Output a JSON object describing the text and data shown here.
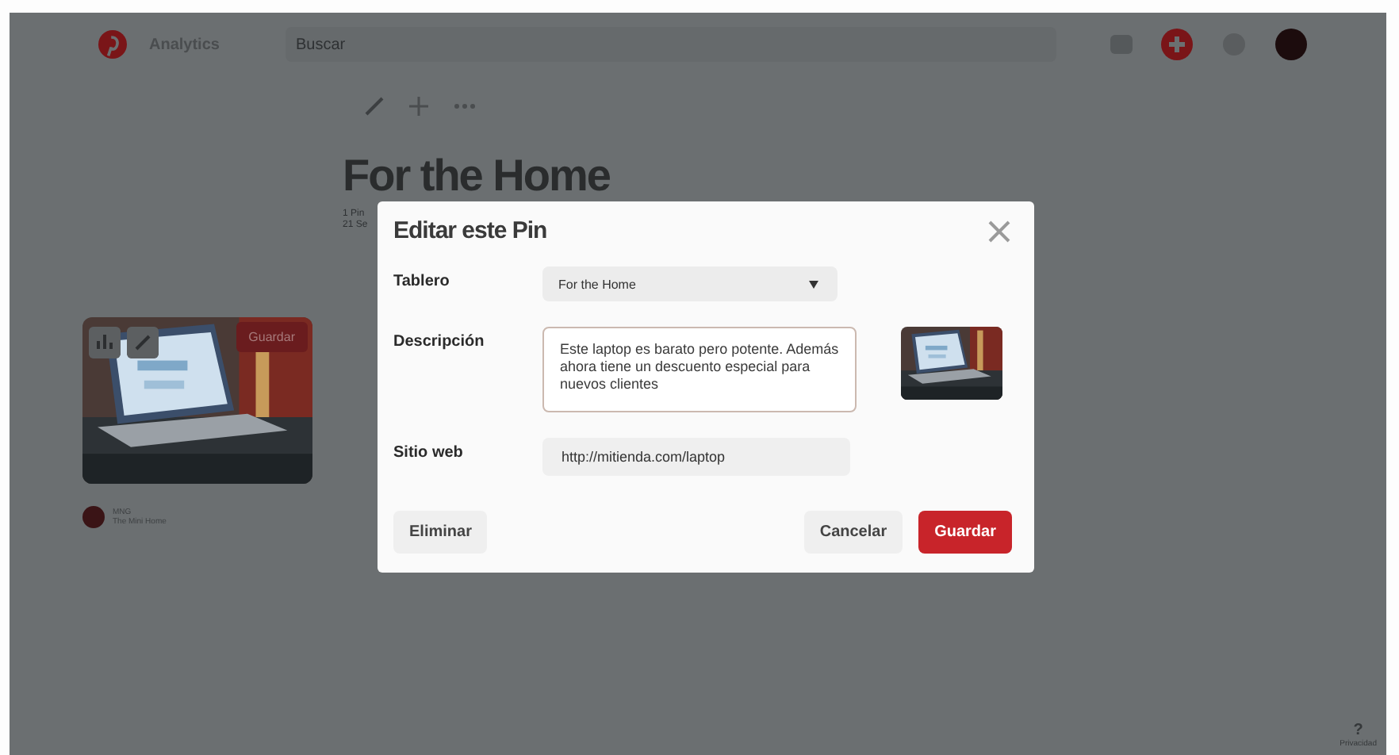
{
  "header": {
    "nav": [
      "Analytics"
    ],
    "search": {
      "placeholder": "Buscar"
    }
  },
  "board": {
    "title": "For the Home",
    "meta": [
      "1 Pin",
      "21 Se"
    ]
  },
  "pin": {
    "save_label": "Guardar",
    "user": "MNG",
    "board_name": "The Mini Home"
  },
  "dialog": {
    "title": "Editar este Pin",
    "fields": [
      {
        "kind": "select",
        "label": "Tablero",
        "value": "For the Home"
      },
      {
        "kind": "textarea",
        "label": "Descripción",
        "value": "Este laptop es barato pero potente. Además ahora tiene un descuento especial para nuevos clientes"
      },
      {
        "kind": "text",
        "label": "Sitio web",
        "value": "http://mitienda.com/laptop"
      }
    ],
    "buttons": [
      {
        "kind": "secondary",
        "label": "Eliminar"
      },
      {
        "kind": "secondary",
        "label": "Cancelar"
      },
      {
        "kind": "primary",
        "label": "Guardar"
      }
    ]
  },
  "help": {
    "label": "?",
    "caption": "Privacidad"
  }
}
